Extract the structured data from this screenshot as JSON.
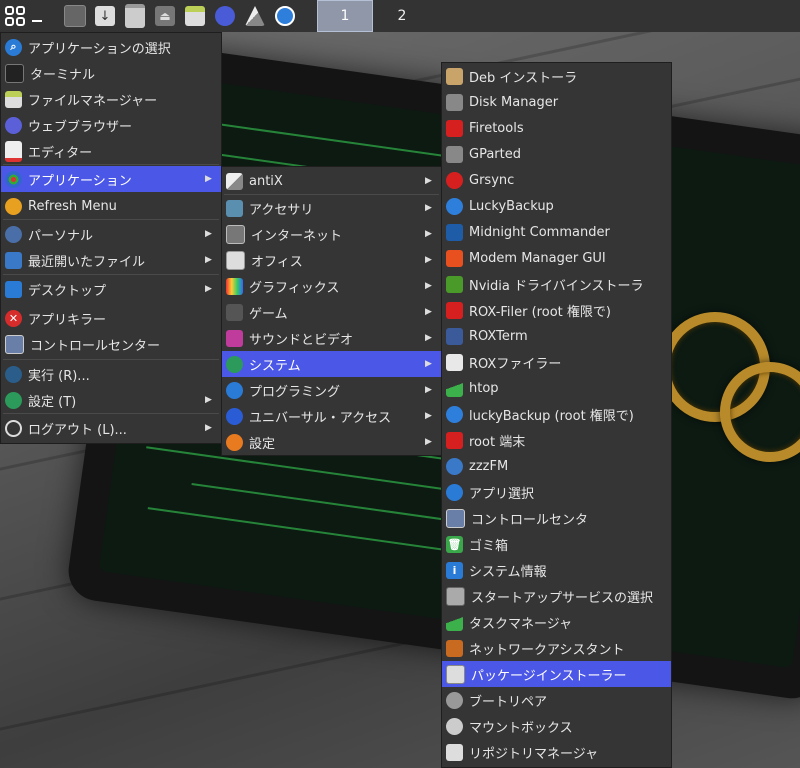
{
  "taskbar": {
    "icons": [
      "app-menu-icon",
      "show-desktop-icon",
      "download-icon",
      "file-manager-icon",
      "eject-icon",
      "drive-icon",
      "browser-icon",
      "antix-icon",
      "updater-icon"
    ],
    "workspaces": [
      "1",
      "2"
    ]
  },
  "main_menu": [
    {
      "label": "アプリケーションの選択",
      "icon": "search-icon"
    },
    {
      "label": "ターミナル",
      "icon": "terminal-icon"
    },
    {
      "label": "ファイルマネージャー",
      "icon": "file-manager-icon"
    },
    {
      "label": "ウェブブラウザー",
      "icon": "browser-icon"
    },
    {
      "label": "エディター",
      "icon": "editor-icon"
    },
    {
      "label": "アプリケーション",
      "icon": "applications-grid-icon"
    },
    {
      "label": "Refresh Menu",
      "icon": "refresh-icon"
    },
    {
      "label": "パーソナル",
      "icon": "person-icon"
    },
    {
      "label": "最近開いたファイル",
      "icon": "recent-files-icon"
    },
    {
      "label": "デスクトップ",
      "icon": "desktop-icon"
    },
    {
      "label": "アプリキラー",
      "icon": "kill-icon"
    },
    {
      "label": "コントロールセンター",
      "icon": "control-center-icon"
    },
    {
      "label": "実行 (R)...",
      "icon": "run-icon"
    },
    {
      "label": "設定 (T)",
      "icon": "settings-icon"
    },
    {
      "label": "ログアウト (L)...",
      "icon": "power-icon"
    }
  ],
  "apps_menu": [
    {
      "label": "antiX",
      "icon": "antix-icon"
    },
    {
      "label": "アクセサリ",
      "icon": "accessories-icon"
    },
    {
      "label": "インターネット",
      "icon": "internet-icon"
    },
    {
      "label": "オフィス",
      "icon": "office-icon"
    },
    {
      "label": "グラフィックス",
      "icon": "graphics-icon"
    },
    {
      "label": "ゲーム",
      "icon": "games-icon"
    },
    {
      "label": "サウンドとビデオ",
      "icon": "multimedia-icon"
    },
    {
      "label": "システム",
      "icon": "system-icon"
    },
    {
      "label": "プログラミング",
      "icon": "programming-icon"
    },
    {
      "label": "ユニバーサル・アクセス",
      "icon": "accessibility-icon"
    },
    {
      "label": "設定",
      "icon": "preferences-icon"
    }
  ],
  "system_menu": [
    {
      "label": "Deb インストーラ",
      "icon": "deb-installer-icon"
    },
    {
      "label": "Disk Manager",
      "icon": "disk-manager-icon"
    },
    {
      "label": "Firetools",
      "icon": "firetools-icon"
    },
    {
      "label": "GParted",
      "icon": "gparted-icon"
    },
    {
      "label": "Grsync",
      "icon": "grsync-icon"
    },
    {
      "label": "LuckyBackup",
      "icon": "luckybackup-icon"
    },
    {
      "label": "Midnight Commander",
      "icon": "midnight-commander-icon"
    },
    {
      "label": "Modem Manager GUI",
      "icon": "modem-manager-icon"
    },
    {
      "label": "Nvidia ドライバインストーラ",
      "icon": "nvidia-icon"
    },
    {
      "label": "ROX-Filer (root 権限で)",
      "icon": "rox-filer-root-icon"
    },
    {
      "label": "ROXTerm",
      "icon": "roxterm-icon"
    },
    {
      "label": "ROXファイラー",
      "icon": "rox-filer-icon"
    },
    {
      "label": "htop",
      "icon": "htop-icon"
    },
    {
      "label": "luckyBackup (root 権限で)",
      "icon": "luckybackup-root-icon"
    },
    {
      "label": "root 端末",
      "icon": "root-terminal-icon"
    },
    {
      "label": "zzzFM",
      "icon": "zzzfm-icon"
    },
    {
      "label": "アプリ選択",
      "icon": "app-select-icon"
    },
    {
      "label": "コントロールセンタ",
      "icon": "control-center-icon"
    },
    {
      "label": "ゴミ箱",
      "icon": "trash-icon"
    },
    {
      "label": "システム情報",
      "icon": "info-icon"
    },
    {
      "label": "スタートアップサービスの選択",
      "icon": "startup-services-icon"
    },
    {
      "label": "タスクマネージャ",
      "icon": "task-manager-icon"
    },
    {
      "label": "ネットワークアシスタント",
      "icon": "network-assistant-icon"
    },
    {
      "label": "パッケージインストーラー",
      "icon": "package-installer-icon"
    },
    {
      "label": "ブートリペア",
      "icon": "boot-repair-icon"
    },
    {
      "label": "マウントボックス",
      "icon": "mountbox-icon"
    },
    {
      "label": "リポジトリマネージャ",
      "icon": "repo-manager-icon"
    }
  ]
}
